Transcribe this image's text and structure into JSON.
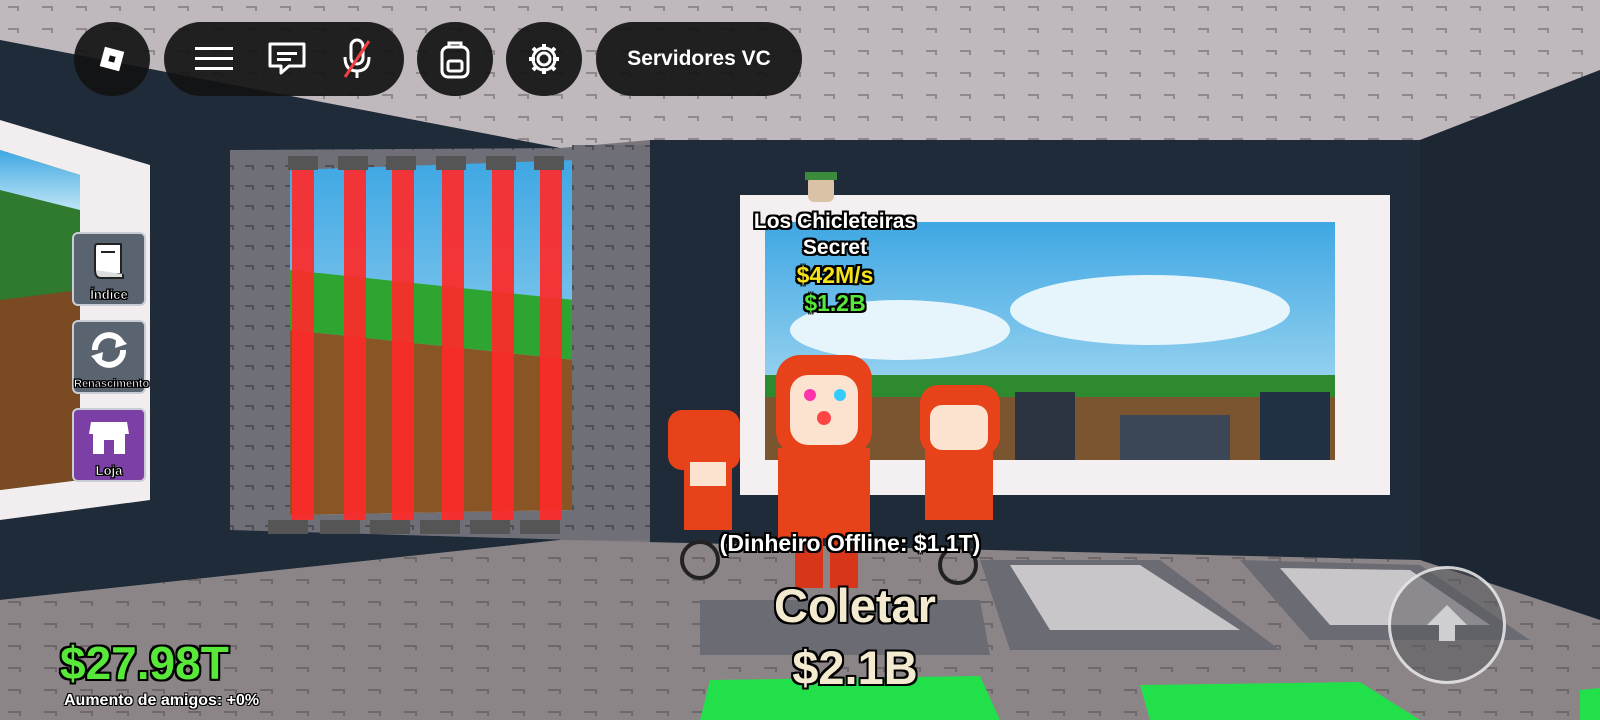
{
  "topbar": {
    "menu_icon": "hamburger-icon",
    "chat_icon": "chat-icon",
    "mic_icon": "mic-muted-icon",
    "backpack_icon": "backpack-icon",
    "settings_icon": "gear-icon",
    "servers_label": "Servidores VC"
  },
  "sidebar": {
    "items": [
      {
        "label": "Índice",
        "icon": "book-icon",
        "color": "#5a6470"
      },
      {
        "label": "Renascimento",
        "icon": "refresh-icon",
        "color": "#5a6470"
      },
      {
        "label": "Loja",
        "icon": "shop-icon",
        "color": "#7b3fa6"
      }
    ]
  },
  "brainrot": {
    "name": "Los Chicleteiras",
    "rarity": "Secret",
    "rate": "$42M/s",
    "value": "$1.2B"
  },
  "collect": {
    "offline_label": "(Dinheiro Offline: $1.1T)",
    "action_label": "Coletar",
    "amount": "$2.1B"
  },
  "wallet": {
    "money": "$27.98T",
    "friends_boost": "Aumento de amigos: +0%"
  },
  "colors": {
    "money_green": "#57e83a",
    "rate_yellow": "#f5e21b",
    "laser_red": "#ff2a2a"
  }
}
